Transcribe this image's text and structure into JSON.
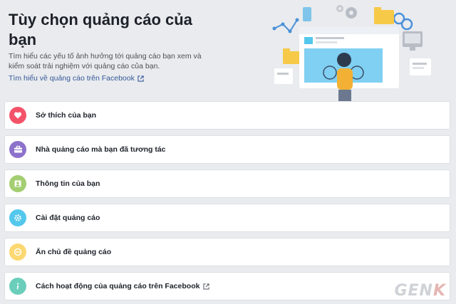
{
  "header": {
    "title": "Tùy chọn quảng cáo của bạn",
    "description": "Tìm hiểu các yếu tố ảnh hưởng tới quảng cáo bạn xem và kiểm soát trải nghiệm với quảng cáo của bạn.",
    "learn_link": "Tìm hiểu về quảng cáo trên Facebook"
  },
  "rows": [
    {
      "label": "Sở thích của bạn",
      "icon": "heart-icon",
      "color": "#f35369"
    },
    {
      "label": "Nhà quảng cáo mà bạn đã tương tác",
      "icon": "briefcase-icon",
      "color": "#8c72cb"
    },
    {
      "label": "Thông tin của bạn",
      "icon": "profile-icon",
      "color": "#a3ce71"
    },
    {
      "label": "Cài đặt quảng cáo",
      "icon": "gear-icon",
      "color": "#54c7ec"
    },
    {
      "label": "Ẩn chủ đề quảng cáo",
      "icon": "hide-icon",
      "color": "#fcd872"
    },
    {
      "label": "Cách hoạt động của quảng cáo trên Facebook",
      "icon": "info-icon",
      "color": "#6bcebb"
    }
  ],
  "watermark": {
    "left": "GEN",
    "right": "K"
  }
}
